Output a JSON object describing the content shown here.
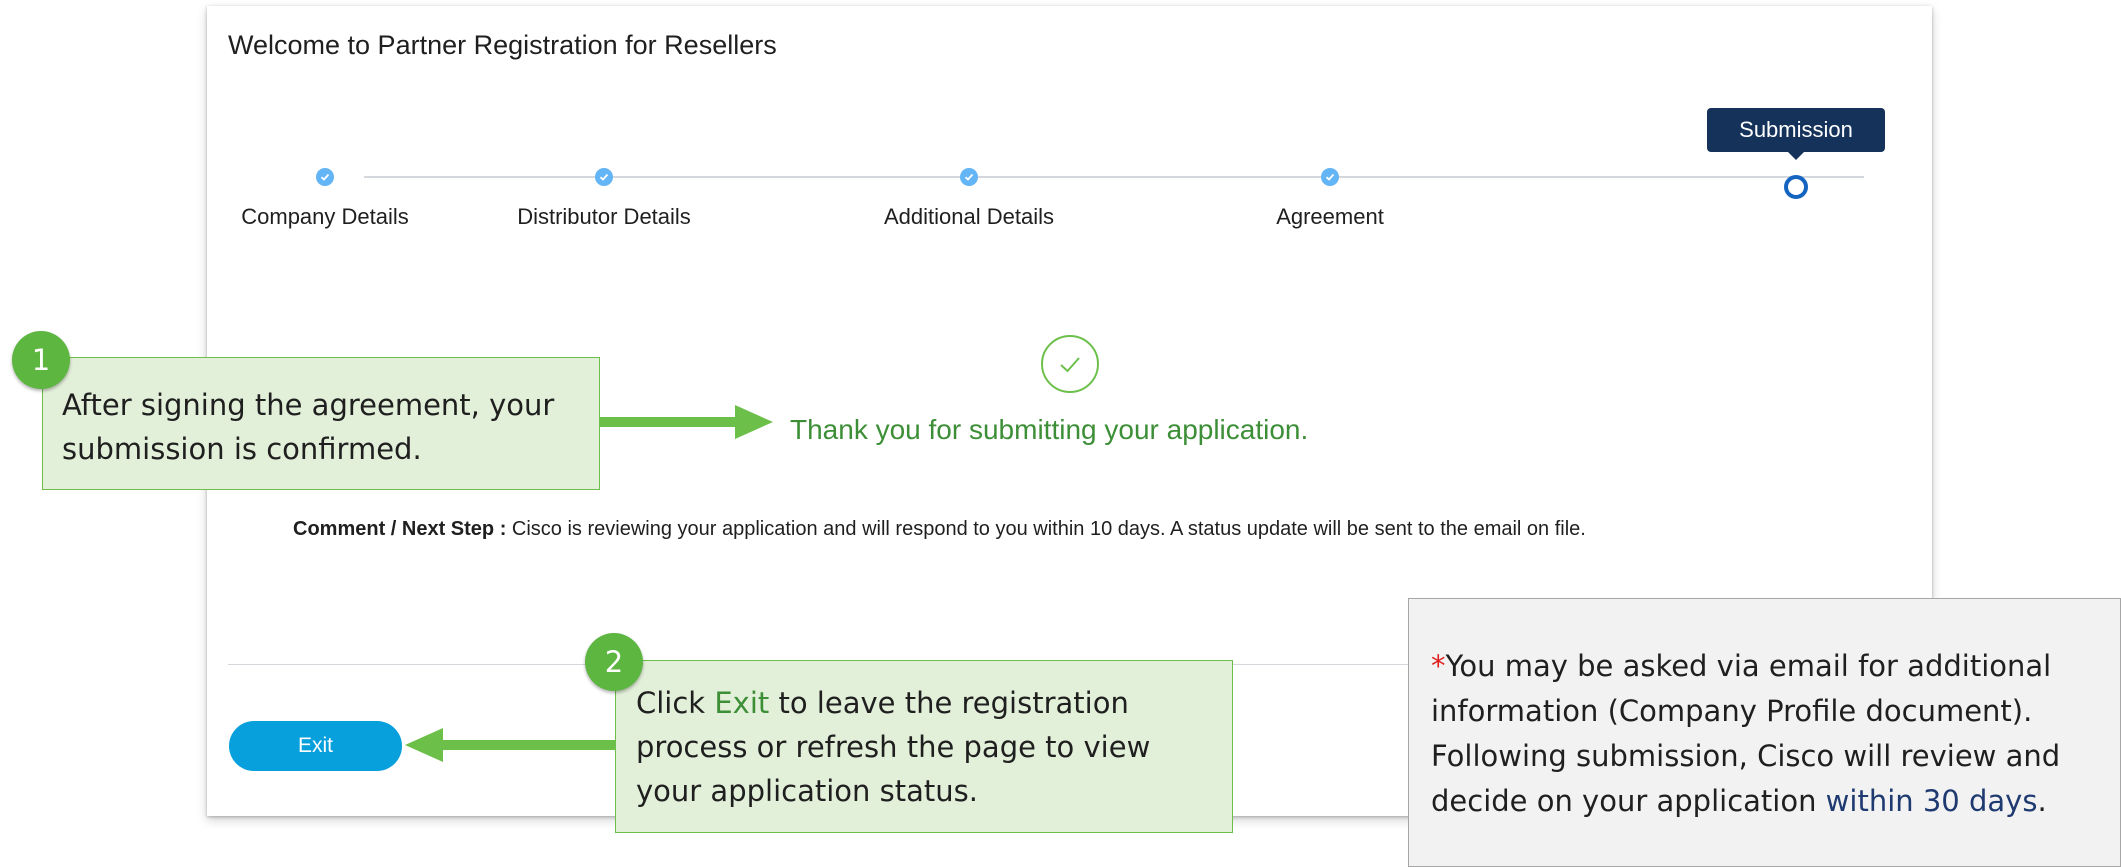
{
  "card": {
    "title": "Welcome to Partner Registration for Resellers"
  },
  "stepper": {
    "steps": [
      {
        "label": "Company Details",
        "status": "complete"
      },
      {
        "label": "Distributor Details",
        "status": "complete"
      },
      {
        "label": "Additional Details",
        "status": "complete"
      },
      {
        "label": "Agreement",
        "status": "complete"
      },
      {
        "label": "Submission",
        "status": "current"
      }
    ],
    "current_tooltip": "Submission"
  },
  "confirmation": {
    "icon": "check-circle-icon",
    "message": "Thank you for submitting your application."
  },
  "comment": {
    "label": "Comment / Next Step :",
    "text": " Cisco is reviewing your application and will respond to you within 10 days. A status update will be sent to the email on file."
  },
  "actions": {
    "exit_label": "Exit"
  },
  "callouts": [
    {
      "number": "1",
      "line1": "After signing the agreement, your",
      "line2": "submission is confirmed."
    },
    {
      "number": "2",
      "line1_pre": "Click ",
      "line1_hl": "Exit",
      "line1_post": " to leave the registration",
      "line2": "process or refresh the page to view",
      "line3": "your application status."
    }
  ],
  "note": {
    "star": "*",
    "line1": "You may be asked via email for additional",
    "line2": "information (Company Profile document).",
    "line3": "Following submission, Cisco will review and",
    "line4_pre": "decide on your application ",
    "line4_hl": "within 30 days",
    "line4_post": "."
  },
  "colors": {
    "accent_blue": "#07a0dc",
    "step_done": "#64b5f6",
    "step_current": "#1565c0",
    "success_green": "#3d8f37",
    "callout_fill": "#e2efd9",
    "callout_border": "#6cc04a",
    "tooltip_bg": "#14325a"
  }
}
